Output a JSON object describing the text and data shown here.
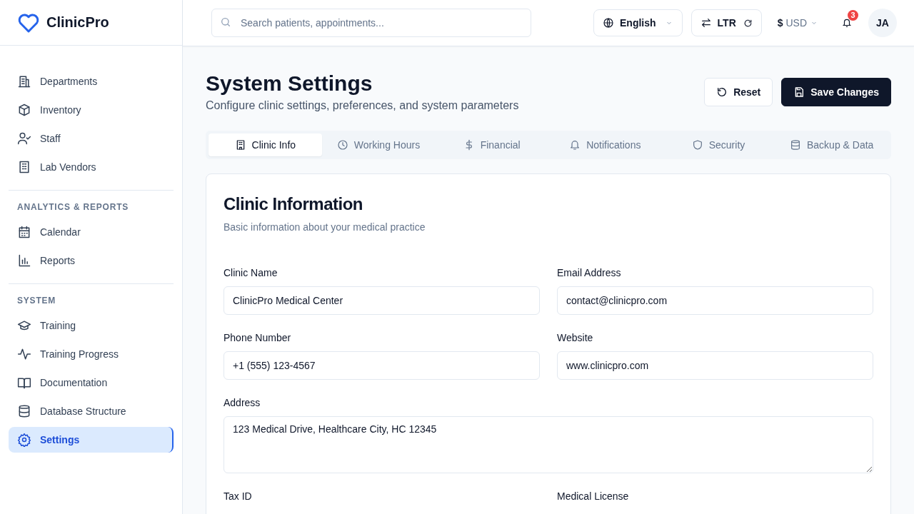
{
  "brand": {
    "name": "ClinicPro"
  },
  "sidebar": {
    "sections": [
      {
        "items": [
          {
            "label": "Departments",
            "selected": false
          },
          {
            "label": "Inventory",
            "selected": false
          },
          {
            "label": "Staff",
            "selected": false
          },
          {
            "label": "Lab Vendors",
            "selected": false
          }
        ]
      },
      {
        "heading": "ANALYTICS & REPORTS",
        "items": [
          {
            "label": "Calendar",
            "selected": false
          },
          {
            "label": "Reports",
            "selected": false
          }
        ]
      },
      {
        "heading": "SYSTEM",
        "items": [
          {
            "label": "Training",
            "selected": false
          },
          {
            "label": "Training Progress",
            "selected": false
          },
          {
            "label": "Documentation",
            "selected": false
          },
          {
            "label": "Database Structure",
            "selected": false
          },
          {
            "label": "Settings",
            "selected": true
          }
        ]
      }
    ]
  },
  "header": {
    "search": {
      "placeholder": "Search patients, appointments..."
    },
    "language": "English",
    "direction": "LTR",
    "currency_symbol": "$",
    "currency": "USD",
    "notification_count": "3",
    "avatar": "JA"
  },
  "page": {
    "title": "System Settings",
    "subtitle": "Configure clinic settings, preferences, and system parameters",
    "buttons": [
      {
        "label": "Reset",
        "kind": "secondary"
      },
      {
        "label": "Save Changes",
        "kind": "primary"
      }
    ]
  },
  "tabs": [
    {
      "label": "Clinic Info",
      "selected": true
    },
    {
      "label": "Working Hours",
      "selected": false
    },
    {
      "label": "Financial",
      "selected": false
    },
    {
      "label": "Notifications",
      "selected": false
    },
    {
      "label": "Security",
      "selected": false
    },
    {
      "label": "Backup & Data",
      "selected": false
    }
  ],
  "card": {
    "title": "Clinic Information",
    "subtitle": "Basic information about your medical practice",
    "fields": [
      {
        "label": "Clinic Name",
        "value": "ClinicPro Medical Center",
        "kind": "input"
      },
      {
        "label": "Email Address",
        "value": "contact@clinicpro.com",
        "kind": "input"
      },
      {
        "label": "Phone Number",
        "value": "+1 (555) 123-4567",
        "kind": "input"
      },
      {
        "label": "Website",
        "value": "www.clinicpro.com",
        "kind": "input"
      },
      {
        "label": "Address",
        "value": "123 Medical Drive, Healthcare City, HC 12345",
        "kind": "textarea"
      },
      {
        "label": "Tax ID",
        "kind": "label"
      },
      {
        "label": "Medical License",
        "kind": "label"
      }
    ]
  }
}
